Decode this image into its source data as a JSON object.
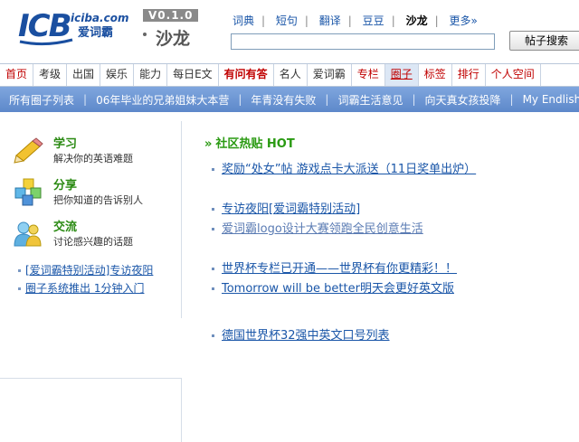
{
  "brand": {
    "logo_text": "ICB",
    "site_domain": "iciba.com",
    "site_name": "爱词霸",
    "version": "V0.1.0",
    "section": "沙龙",
    "colors": {
      "logo_blue": "#1a4fa0",
      "link_blue": "#1a56a8",
      "green_title": "#2a8a12",
      "red_tab": "#c00000",
      "subnav_blue": "#6a93d2"
    }
  },
  "topnav": {
    "items": [
      "词典",
      "短句",
      "翻译",
      "豆豆",
      "沙龙",
      "更多»"
    ],
    "active": "沙龙"
  },
  "search": {
    "value": "",
    "button_label": "帖子搜索"
  },
  "tabs": [
    "首页",
    "考级",
    "出国",
    "娱乐",
    "能力",
    "每日E文",
    "有问有答",
    "名人",
    "爱词霸",
    "专栏",
    "圈子",
    "标签",
    "排行",
    "个人空间"
  ],
  "subnav": [
    "所有圈子列表",
    "06年毕业的兄弟姐妹大本营",
    "年青没有失败",
    "词霸生活意见",
    "向天真女孩投降",
    "My Endlish"
  ],
  "sidebar": {
    "features": [
      {
        "title": "学习",
        "desc": "解决你的英语难题",
        "icon": "pencil-icon"
      },
      {
        "title": "分享",
        "desc": "把你知道的告诉别人",
        "icon": "cubes-icon"
      },
      {
        "title": "交流",
        "desc": "讨论感兴趣的话题",
        "icon": "people-icon"
      }
    ],
    "links": [
      "[爱词霸特别活动]专访夜阳",
      "圈子系统推出  1分钟入门"
    ]
  },
  "hot": {
    "title": "社区热贴  HOT",
    "posts": [
      "奖励“处女”帖  游戏点卡大派送（11日奖单出炉）",
      "专访夜阳[爱词霸特别活动]",
      "爱词霸logo设计大赛领跑全民创意生活",
      "世界杯专栏已开通——世界杯有你更精彩！！",
      "Tomorrow will be better明天会更好英文版",
      "德国世界杯32强中英文口号列表"
    ]
  }
}
